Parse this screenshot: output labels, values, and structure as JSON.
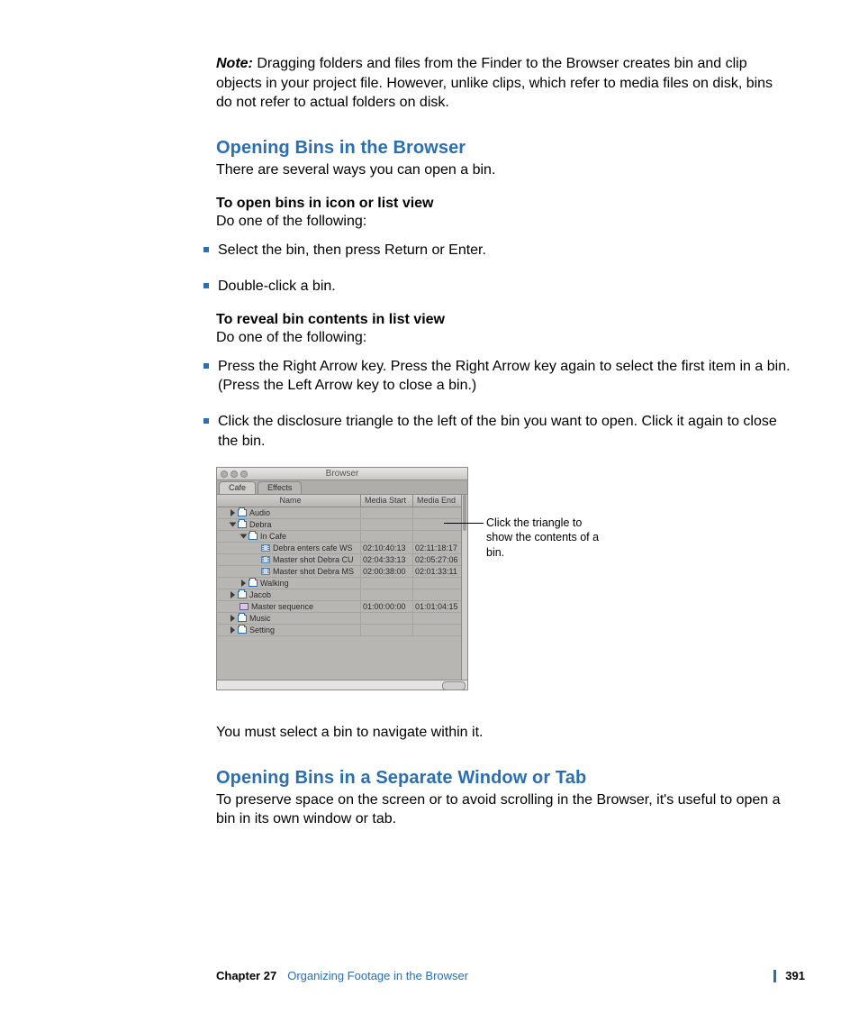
{
  "note": {
    "label": "Note:",
    "text": "Dragging folders and files from the Finder to the Browser creates bin and clip objects in your project file. However, unlike clips, which refer to media files on disk, bins do not refer to actual folders on disk."
  },
  "section1": {
    "heading": "Opening Bins in the Browser",
    "intro": "There are several ways you can open a bin.",
    "sub1_head": "To open bins in icon or list view",
    "sub1_follow": "Do one of the following:",
    "bullets1": [
      "Select the bin, then press Return or Enter.",
      "Double-click a bin."
    ],
    "sub2_head": "To reveal bin contents in list view",
    "sub2_follow": "Do one of the following:",
    "bullets2": [
      "Press the Right Arrow key. Press the Right Arrow key again to select the first item in a bin. (Press the Left Arrow key to close a bin.)",
      "Click the disclosure triangle to the left of the bin you want to open. Click it again to close the bin."
    ],
    "after_fig": "You must select a bin to navigate within it."
  },
  "figure": {
    "window_title": "Browser",
    "tabs": [
      "Cafe",
      "Effects"
    ],
    "columns": [
      "Name",
      "Media Start",
      "Media End"
    ],
    "rows": [
      {
        "indent": 1,
        "tri": "right",
        "icon": "bin",
        "name": "Audio",
        "ms": "",
        "me": ""
      },
      {
        "indent": 1,
        "tri": "down",
        "icon": "bin",
        "name": "Debra",
        "ms": "",
        "me": ""
      },
      {
        "indent": 2,
        "tri": "down",
        "icon": "bin",
        "name": "In Cafe",
        "ms": "",
        "me": ""
      },
      {
        "indent": 3,
        "tri": "",
        "icon": "clip",
        "name": "Debra enters cafe WS",
        "ms": "02:10:40:13",
        "me": "02:11:18:17"
      },
      {
        "indent": 3,
        "tri": "",
        "icon": "clip",
        "name": "Master shot Debra CU",
        "ms": "02:04:33:13",
        "me": "02:05:27:06"
      },
      {
        "indent": 3,
        "tri": "",
        "icon": "clip",
        "name": "Master shot Debra MS",
        "ms": "02:00:38:00",
        "me": "02:01:33:11"
      },
      {
        "indent": 2,
        "tri": "right",
        "icon": "bin",
        "name": "Walking",
        "ms": "",
        "me": ""
      },
      {
        "indent": 1,
        "tri": "right",
        "icon": "bin",
        "name": "Jacob",
        "ms": "",
        "me": ""
      },
      {
        "indent": 1,
        "tri": "",
        "icon": "seq",
        "name": "Master sequence",
        "ms": "01:00:00:00",
        "me": "01:01:04:15"
      },
      {
        "indent": 1,
        "tri": "right",
        "icon": "bin",
        "name": "Music",
        "ms": "",
        "me": ""
      },
      {
        "indent": 1,
        "tri": "right",
        "icon": "bin",
        "name": "Setting",
        "ms": "",
        "me": ""
      }
    ],
    "callout": "Click the triangle to show the contents of a bin."
  },
  "section2": {
    "heading": "Opening Bins in a Separate Window or Tab",
    "intro": "To preserve space on the screen or to avoid scrolling in the Browser, it's useful to open a bin in its own window or tab."
  },
  "footer": {
    "chapter": "Chapter 27",
    "title": "Organizing Footage in the Browser",
    "page": "391"
  }
}
